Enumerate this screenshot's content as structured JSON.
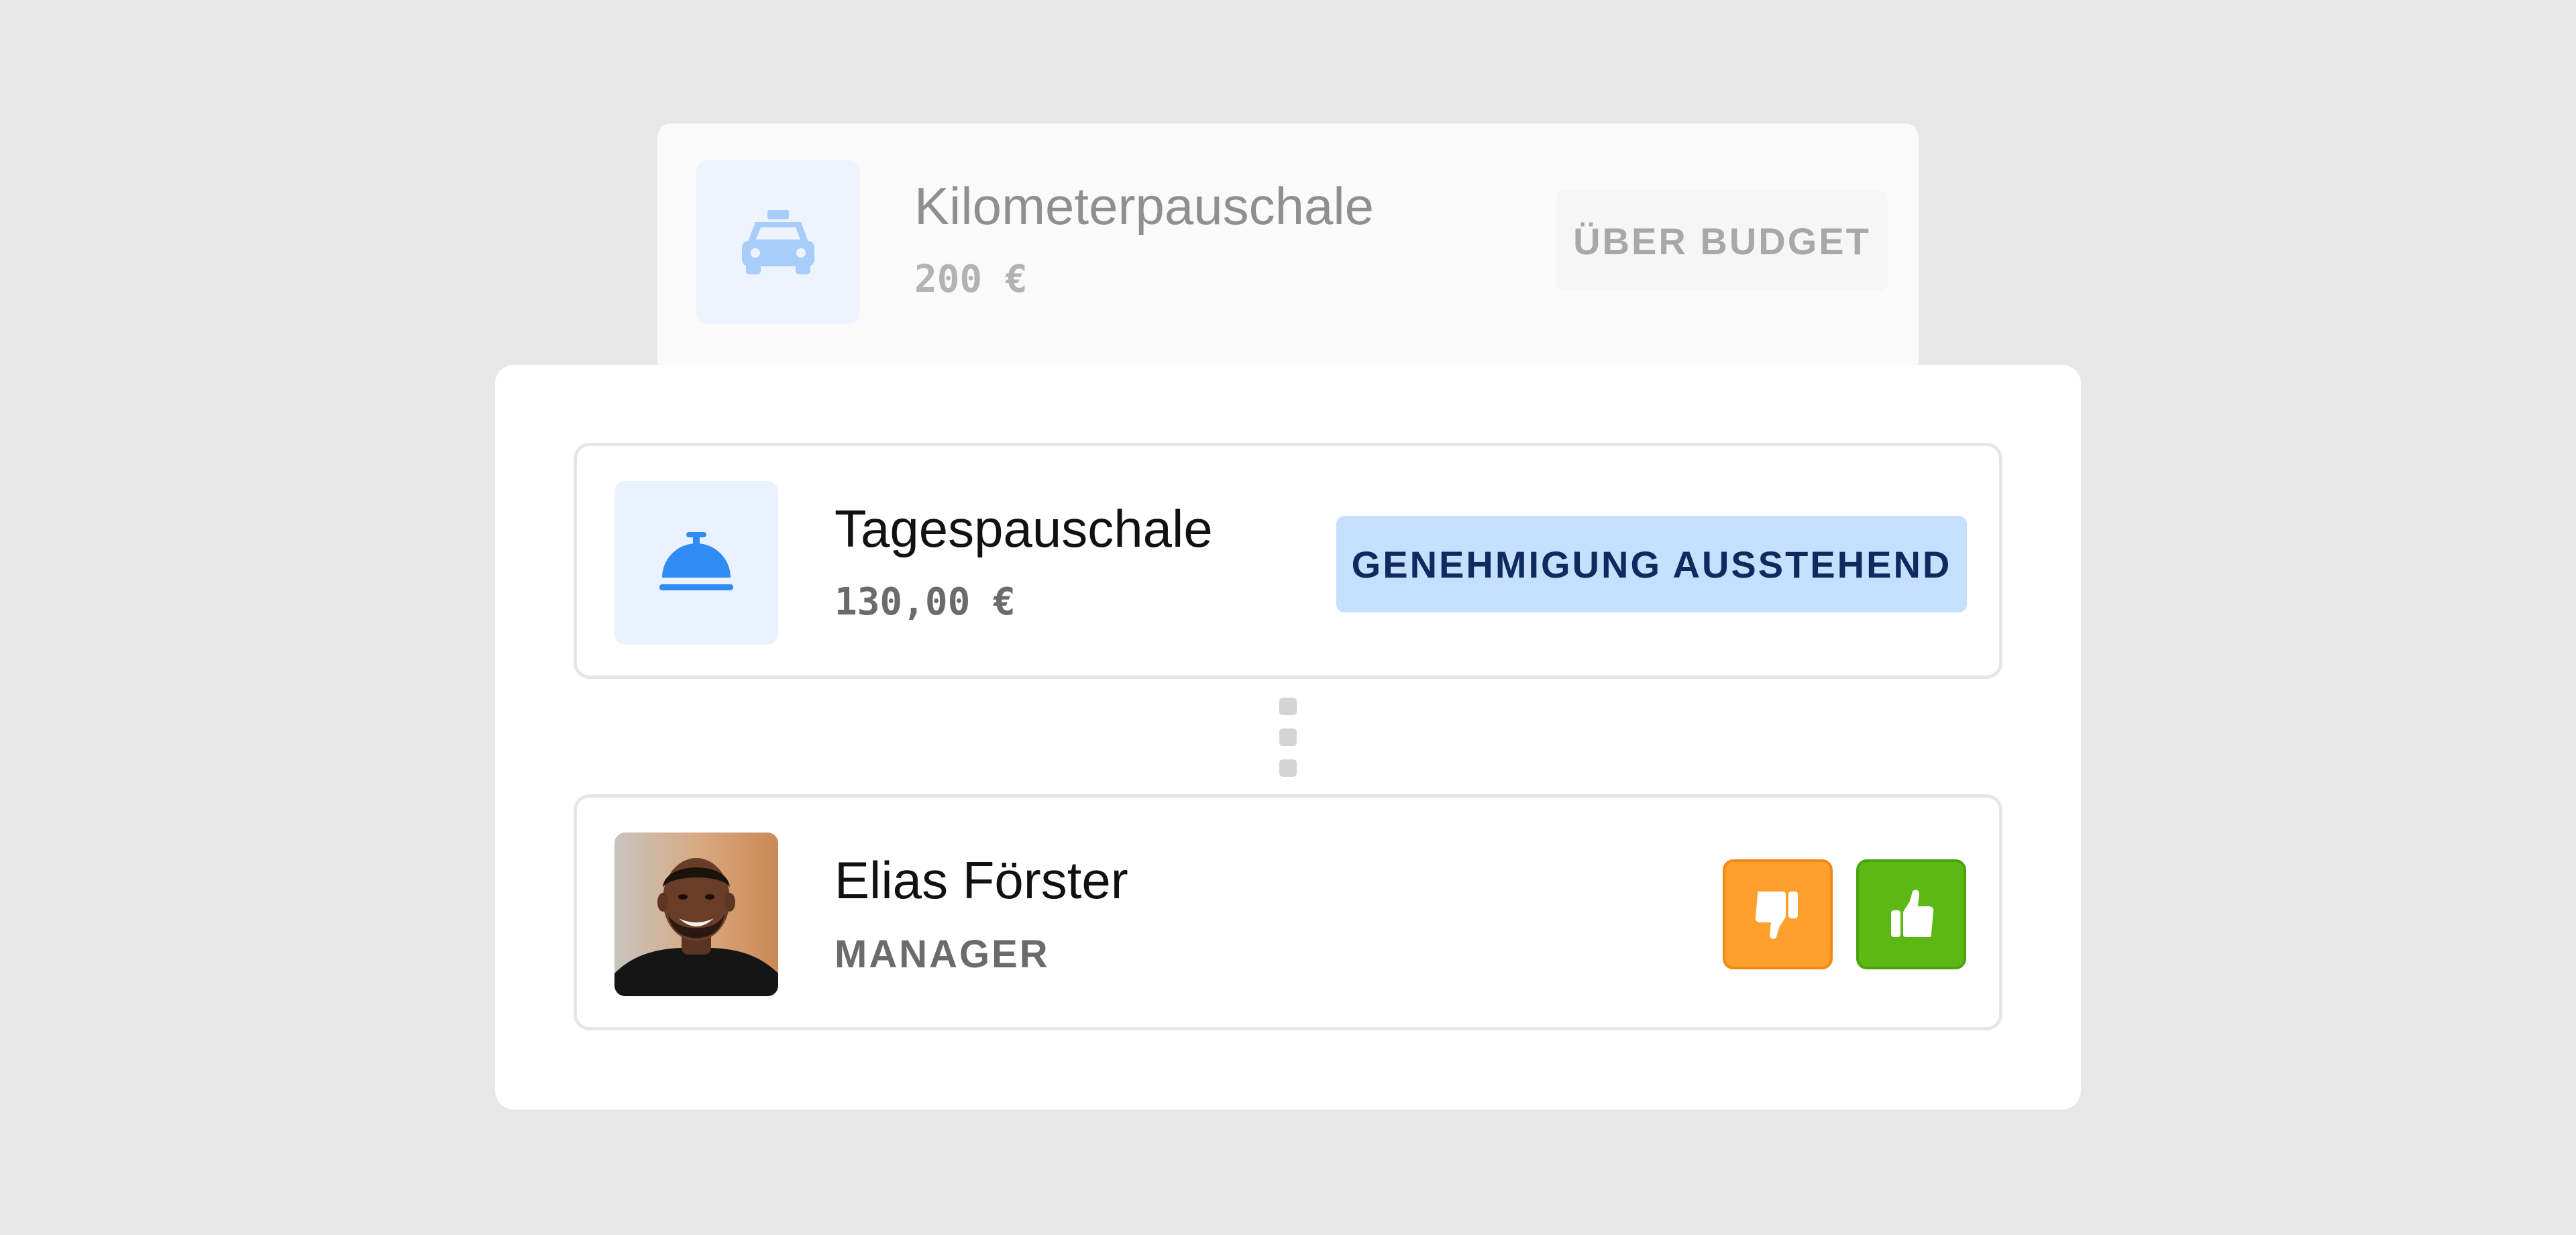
{
  "background_expense": {
    "icon": "taxi-icon",
    "title": "Kilometerpauschale",
    "amount": "200 €",
    "badge": "ÜBER BUDGET"
  },
  "expense": {
    "icon": "service-bell-icon",
    "title": "Tagespauschale",
    "amount": "130,00 €",
    "status": "GENEHMIGUNG AUSSTEHEND"
  },
  "approver": {
    "name": "Elias Förster",
    "role": "MANAGER",
    "reject_icon": "thumbs-down-icon",
    "approve_icon": "thumbs-up-icon"
  },
  "colors": {
    "page_background": "#e7e7e7",
    "status_badge_bg": "#c5e0fc",
    "status_badge_text": "#0f2a5f",
    "icon_blue": "#2f8cf5",
    "reject_orange": "#ff9f2e",
    "approve_green": "#5cb815"
  }
}
